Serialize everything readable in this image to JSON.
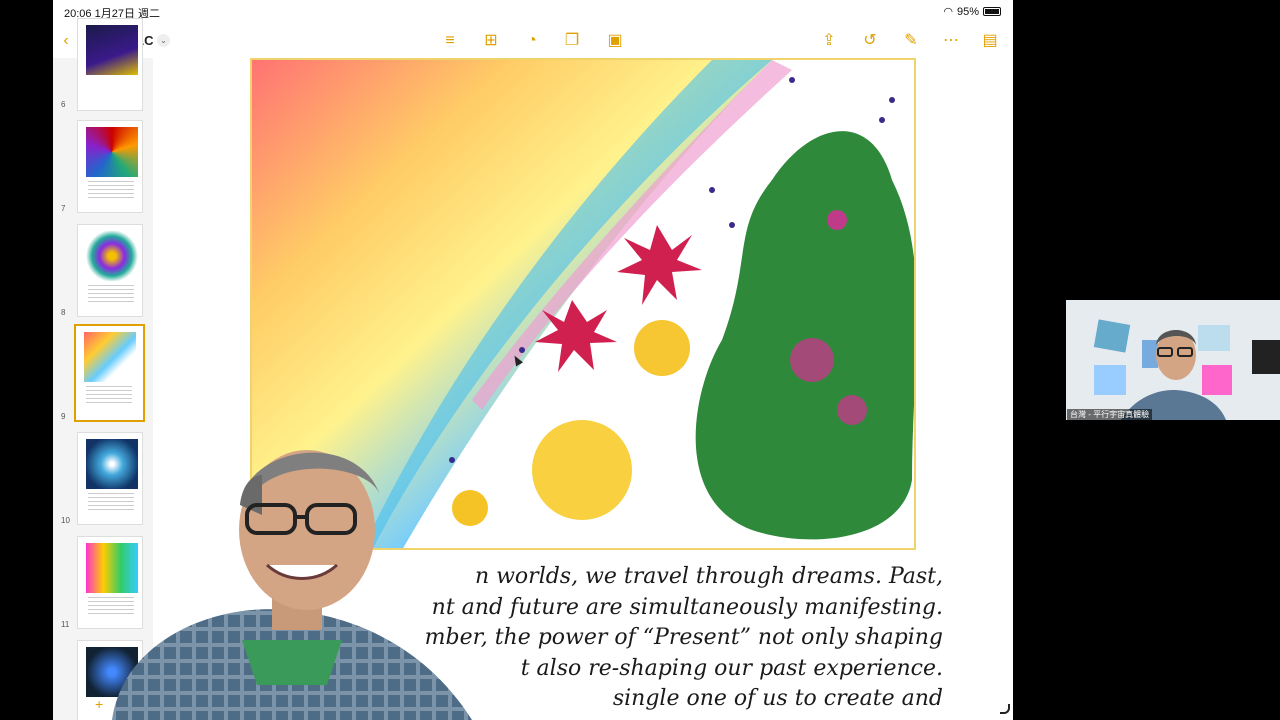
{
  "status": {
    "time": "20:06",
    "date": "1月27日 週二",
    "battery": "95%"
  },
  "toolbar": {
    "title": "VAC"
  },
  "sidebar": {
    "pages": [
      {
        "num": "6"
      },
      {
        "num": "7"
      },
      {
        "num": "8"
      },
      {
        "num": "9"
      },
      {
        "num": "10"
      },
      {
        "num": "11"
      }
    ]
  },
  "slide": {
    "lines": [
      "n worlds, we travel through dreams. Past,",
      "nt and future are simultaneously manifesting.",
      "mber, the power of “Present” not only shaping",
      "t also re-shaping our past experience.",
      "single one of us to create and"
    ]
  },
  "camera": {
    "label": "台灣 - 平行宇宙真體驗"
  },
  "colors": {
    "accent": "#e0a000",
    "frame": "#f1d36b"
  }
}
